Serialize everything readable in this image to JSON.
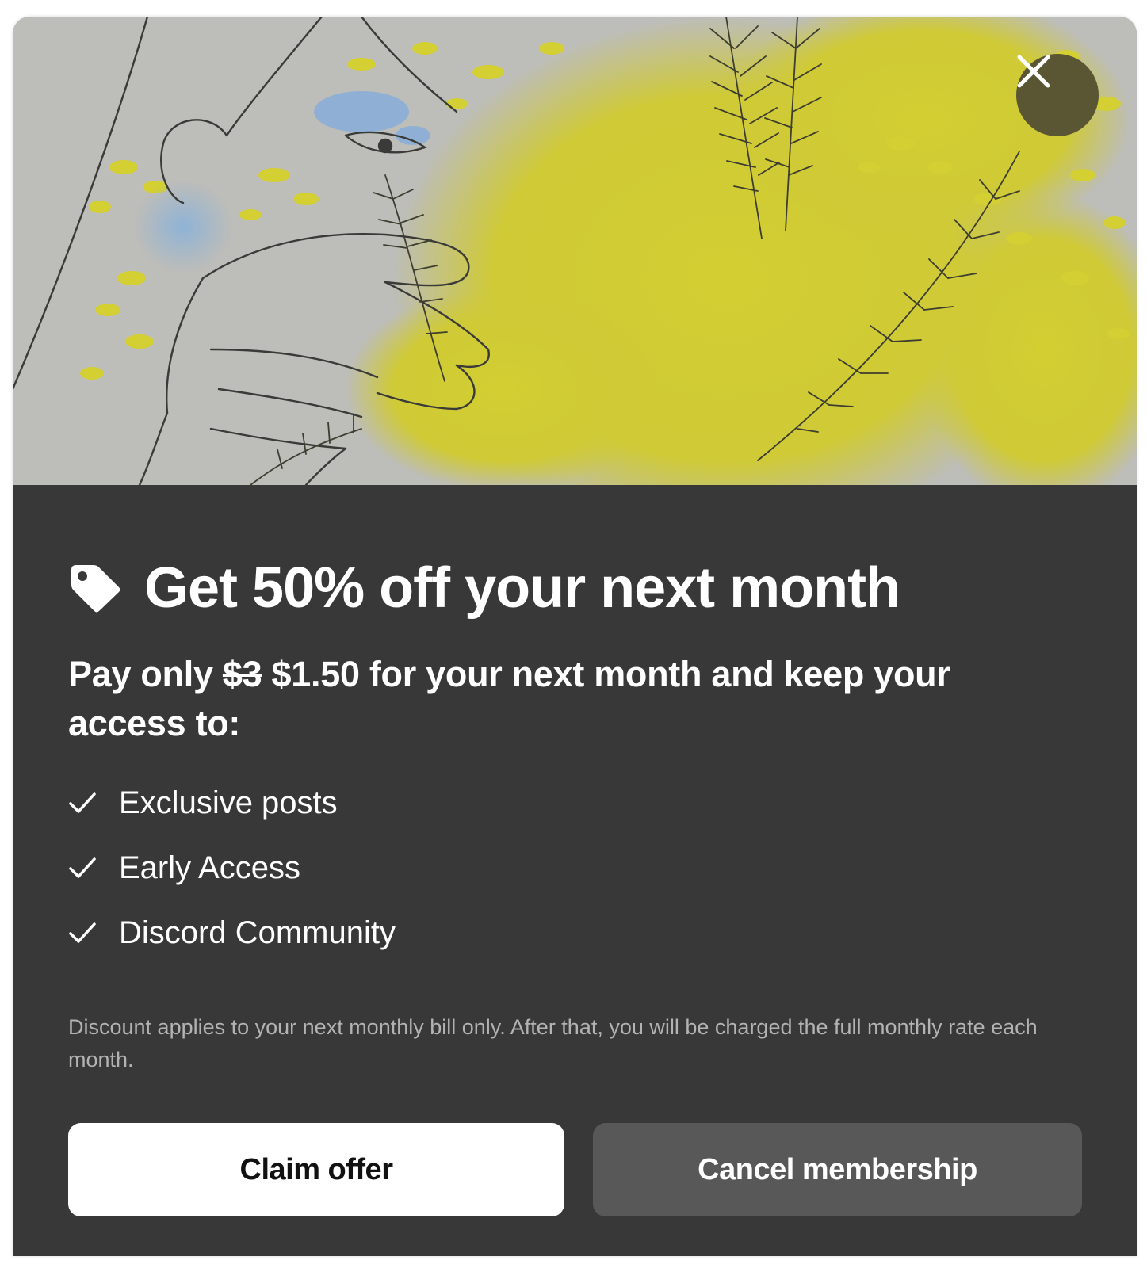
{
  "colors": {
    "panel": "#383838",
    "accent_yellow": "#d4cf33",
    "close_button": "#5a5533",
    "claim_button": "#ffffff",
    "cancel_button": "#585858"
  },
  "hero": {
    "icon": "illustration-hand-with-plants"
  },
  "close": {
    "icon": "close-icon"
  },
  "offer": {
    "icon": "tag-icon",
    "headline": "Get 50% off your next month",
    "pay_prefix": "Pay only ",
    "old_price": "$3",
    "new_price": " $1.50",
    "pay_suffix": " for your next month and keep your access to:"
  },
  "features": [
    {
      "icon": "check-icon",
      "label": "Exclusive posts"
    },
    {
      "icon": "check-icon",
      "label": "Early Access"
    },
    {
      "icon": "check-icon",
      "label": "Discord Community"
    }
  ],
  "disclaimer": "Discount applies to your next monthly bill only. After that, you will be charged the full monthly rate each month.",
  "buttons": {
    "claim": "Claim offer",
    "cancel": "Cancel membership"
  }
}
